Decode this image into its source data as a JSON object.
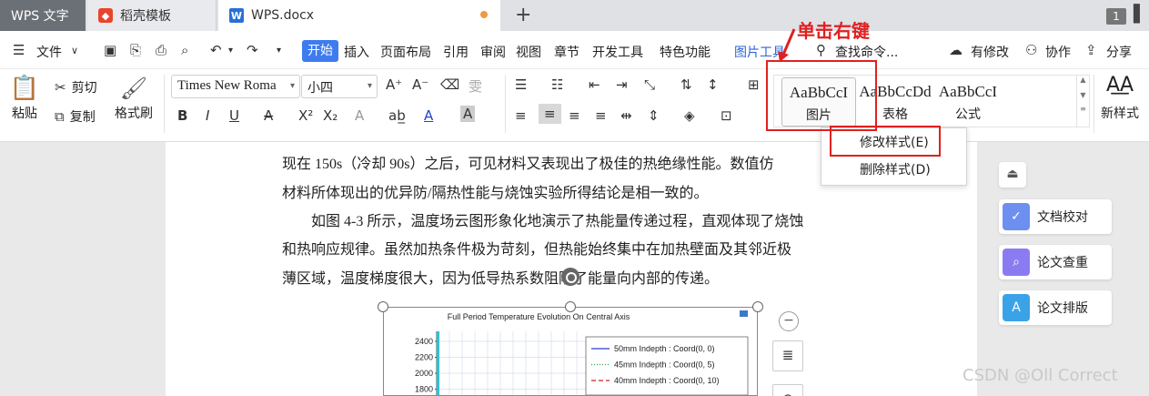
{
  "tabs": {
    "wps": "WPS 文字",
    "template": "稻壳模板",
    "doc": "WPS.docx",
    "badge": "1"
  },
  "menubar": {
    "file": "文件",
    "items": [
      "开始",
      "插入",
      "页面布局",
      "引用",
      "审阅",
      "视图",
      "章节",
      "开发工具",
      "特色功能"
    ],
    "picture_tools": "图片工具",
    "search": "查找命令...",
    "modified": "有修改",
    "collaborate": "协作",
    "share": "分享"
  },
  "ribbon": {
    "paste": "粘贴",
    "cut": "剪切",
    "copy": "复制",
    "format_painter": "格式刷",
    "font": "Times New Roma",
    "size": "小四",
    "styles": [
      {
        "sample": "AaBbCcI",
        "name": "图片"
      },
      {
        "sample": "AaBbCcDd",
        "name": "表格"
      },
      {
        "sample": "AaBbCcI",
        "name": "公式"
      }
    ],
    "new_style": "新样式"
  },
  "annotation": {
    "text": "单击右键"
  },
  "context_menu": {
    "modify": "修改样式(E)",
    "delete": "删除样式(D)"
  },
  "document": {
    "lines": [
      "现在 150s（冷却 90s）之后，可见材料又表现出了极佳的热绝缘性能。数值仿",
      "材料所体现出的优异防/隔热性能与烧蚀实验所得结论是相一致的。",
      "　　如图 4-3 所示，温度场云图形象化地演示了热能量传递过程，直观体现了烧蚀",
      "和热响应规律。虽然加热条件极为苛刻，但热能始终集中在加热壁面及其邻近极",
      "薄区域，温度梯度很大，因为低导热系数阻隔了能量向内部的传递。"
    ]
  },
  "chart_data": {
    "type": "line",
    "title": "Full Period Temperature Evolution On Central Axis",
    "yticks": [
      2400,
      2200,
      2000,
      1800
    ],
    "series": [
      {
        "name": "50mm Indepth : Coord(0, 0)",
        "color": "#2a3fc9",
        "dash": "solid"
      },
      {
        "name": "45mm Indepth : Coord(0, 5)",
        "color": "#2aa04a",
        "dash": "dotted"
      },
      {
        "name": "40mm Indepth : Coord(0, 10)",
        "color": "#d02020",
        "dash": "dashed"
      }
    ]
  },
  "side_tools": {
    "proofread": "文档校对",
    "plagiarism": "论文查重",
    "layout": "论文排版"
  },
  "watermark": "CSDN @Oll Correct"
}
